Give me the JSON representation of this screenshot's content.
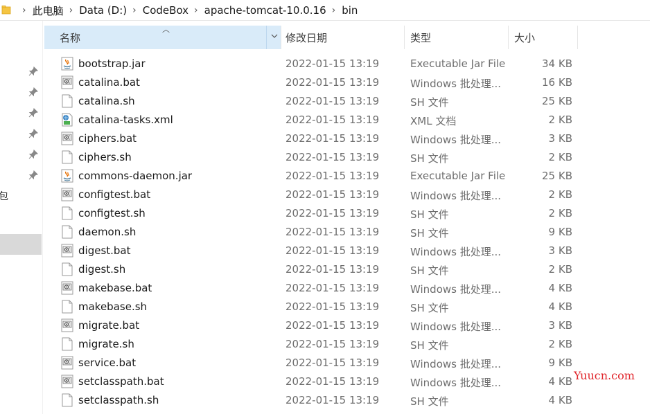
{
  "address": {
    "crumbs": [
      "此电脑",
      "Data (D:)",
      "CodeBox",
      "apache-tomcat-10.0.16",
      "bin"
    ]
  },
  "nav": {
    "fragment": "包"
  },
  "columns": {
    "name": "名称",
    "date": "修改日期",
    "type": "类型",
    "size": "大小"
  },
  "files": [
    {
      "name": "bootstrap.jar",
      "date": "2022-01-15 13:19",
      "type": "Executable Jar File",
      "size": "34 KB",
      "icon": "jar-file-icon"
    },
    {
      "name": "catalina.bat",
      "date": "2022-01-15 13:19",
      "type": "Windows 批处理...",
      "size": "16 KB",
      "icon": "bat-file-icon"
    },
    {
      "name": "catalina.sh",
      "date": "2022-01-15 13:19",
      "type": "SH 文件",
      "size": "25 KB",
      "icon": "sh-file-icon"
    },
    {
      "name": "catalina-tasks.xml",
      "date": "2022-01-15 13:19",
      "type": "XML 文档",
      "size": "2 KB",
      "icon": "xml-file-icon"
    },
    {
      "name": "ciphers.bat",
      "date": "2022-01-15 13:19",
      "type": "Windows 批处理...",
      "size": "3 KB",
      "icon": "bat-file-icon"
    },
    {
      "name": "ciphers.sh",
      "date": "2022-01-15 13:19",
      "type": "SH 文件",
      "size": "2 KB",
      "icon": "sh-file-icon"
    },
    {
      "name": "commons-daemon.jar",
      "date": "2022-01-15 13:19",
      "type": "Executable Jar File",
      "size": "25 KB",
      "icon": "jar-file-icon"
    },
    {
      "name": "configtest.bat",
      "date": "2022-01-15 13:19",
      "type": "Windows 批处理...",
      "size": "2 KB",
      "icon": "bat-file-icon"
    },
    {
      "name": "configtest.sh",
      "date": "2022-01-15 13:19",
      "type": "SH 文件",
      "size": "2 KB",
      "icon": "sh-file-icon"
    },
    {
      "name": "daemon.sh",
      "date": "2022-01-15 13:19",
      "type": "SH 文件",
      "size": "9 KB",
      "icon": "sh-file-icon"
    },
    {
      "name": "digest.bat",
      "date": "2022-01-15 13:19",
      "type": "Windows 批处理...",
      "size": "3 KB",
      "icon": "bat-file-icon"
    },
    {
      "name": "digest.sh",
      "date": "2022-01-15 13:19",
      "type": "SH 文件",
      "size": "2 KB",
      "icon": "sh-file-icon"
    },
    {
      "name": "makebase.bat",
      "date": "2022-01-15 13:19",
      "type": "Windows 批处理...",
      "size": "4 KB",
      "icon": "bat-file-icon"
    },
    {
      "name": "makebase.sh",
      "date": "2022-01-15 13:19",
      "type": "SH 文件",
      "size": "4 KB",
      "icon": "sh-file-icon"
    },
    {
      "name": "migrate.bat",
      "date": "2022-01-15 13:19",
      "type": "Windows 批处理...",
      "size": "3 KB",
      "icon": "bat-file-icon"
    },
    {
      "name": "migrate.sh",
      "date": "2022-01-15 13:19",
      "type": "SH 文件",
      "size": "2 KB",
      "icon": "sh-file-icon"
    },
    {
      "name": "service.bat",
      "date": "2022-01-15 13:19",
      "type": "Windows 批处理...",
      "size": "9 KB",
      "icon": "bat-file-icon"
    },
    {
      "name": "setclasspath.bat",
      "date": "2022-01-15 13:19",
      "type": "Windows 批处理...",
      "size": "4 KB",
      "icon": "bat-file-icon"
    },
    {
      "name": "setclasspath.sh",
      "date": "2022-01-15 13:19",
      "type": "SH 文件",
      "size": "4 KB",
      "icon": "sh-file-icon"
    }
  ],
  "watermark": "Yuucn.com",
  "colors": {
    "header_selected": "#d9ebf9",
    "watermark": "#e0242a",
    "secondary_text": "#6d6d6d"
  }
}
